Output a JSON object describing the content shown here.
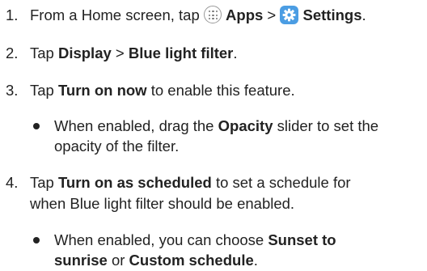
{
  "steps": [
    {
      "number": "1.",
      "pre": "From a Home screen, tap",
      "apps_icon": "apps-grid-icon",
      "apps": "Apps",
      "sep": ">",
      "settings_icon": "settings-gear-icon",
      "settings": "Settings",
      "end": "."
    },
    {
      "number": "2.",
      "pre": "Tap",
      "display": "Display",
      "sep": ">",
      "blf": "Blue light filter",
      "end": "."
    },
    {
      "number": "3.",
      "pre": "Tap",
      "turn_on": "Turn on now",
      "post": "to enable this feature.",
      "bullet": {
        "pre": "When enabled, drag the",
        "opacity": "Opacity",
        "post": "slider to set the",
        "line2": "opacity of the filter."
      }
    },
    {
      "number": "4.",
      "pre": "Tap",
      "scheduled": "Turn on as scheduled",
      "post": "to set a schedule for",
      "line2": "when Blue light filter should be enabled.",
      "bullet": {
        "pre": "When enabled, you can choose",
        "sunset": "Sunset to",
        "sunrise": "sunrise",
        "or": "or",
        "custom": "Custom schedule",
        "end": "."
      }
    }
  ],
  "colors": {
    "text": "#222222",
    "settings_icon_bg": "#4b9de3"
  }
}
